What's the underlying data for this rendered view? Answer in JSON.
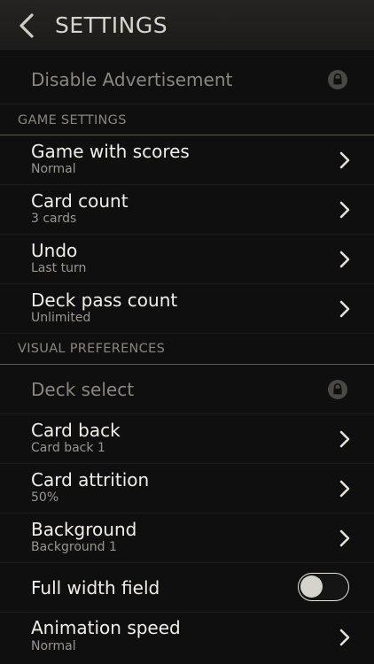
{
  "header": {
    "title": "SETTINGS",
    "back_icon": "chevron-left-icon"
  },
  "ads": {
    "label": "Disable Advertisement",
    "locked": true,
    "icon": "lock-icon"
  },
  "game_settings": {
    "header": "GAME SETTINGS",
    "items": [
      {
        "label": "Game with scores",
        "value": "Normal"
      },
      {
        "label": "Card count",
        "value": "3 cards"
      },
      {
        "label": "Undo",
        "value": "Last turn"
      },
      {
        "label": "Deck pass count",
        "value": "Unlimited"
      }
    ]
  },
  "visual_preferences": {
    "header": "VISUAL PREFERENCES",
    "deck_select": {
      "label": "Deck select",
      "locked": true,
      "icon": "lock-icon"
    },
    "items": [
      {
        "label": "Card back",
        "value": "Card back 1"
      },
      {
        "label": "Card attrition",
        "value": "50%"
      },
      {
        "label": "Background",
        "value": "Background 1"
      }
    ],
    "full_width": {
      "label": "Full width field",
      "enabled": false
    },
    "animation": {
      "label": "Animation speed",
      "value": "Normal"
    }
  },
  "colors": {
    "background": "#0f0f0f",
    "header": "#211f1d",
    "text": "#f2efe8",
    "subtext": "#9a968f",
    "section_divider": "#5d5a52"
  }
}
